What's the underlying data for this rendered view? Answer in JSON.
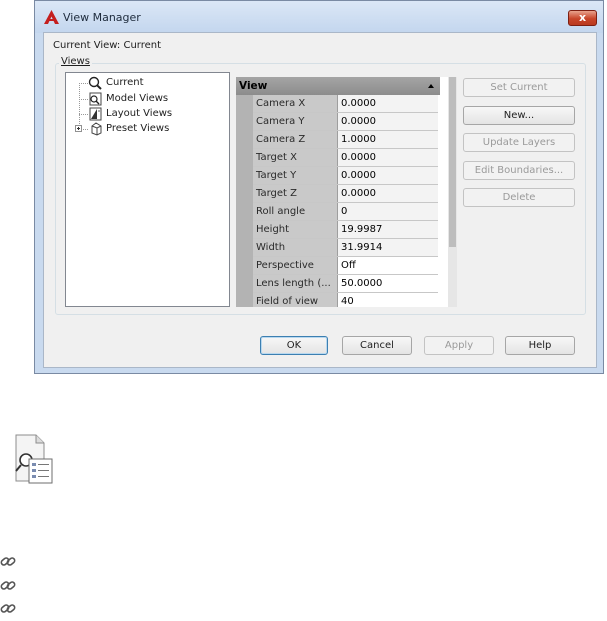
{
  "window": {
    "title": "View Manager",
    "close_glyph": "x",
    "brand_color": "#c41e1e"
  },
  "current_view": "Current View: Current",
  "views_group": {
    "label": "Views",
    "tree": [
      {
        "label": "Current",
        "icon": "magnifier-icon",
        "selected": true
      },
      {
        "label": "Model Views",
        "icon": "model-views-icon",
        "selected": false
      },
      {
        "label": "Layout Views",
        "icon": "layout-views-icon",
        "selected": false
      },
      {
        "label": "Preset Views",
        "icon": "preset-views-icon",
        "selected": false,
        "expandable": true
      }
    ]
  },
  "properties": {
    "header": "View",
    "rows": [
      {
        "name": "Camera X",
        "value": "0.0000"
      },
      {
        "name": "Camera Y",
        "value": "0.0000"
      },
      {
        "name": "Camera Z",
        "value": "1.0000"
      },
      {
        "name": "Target X",
        "value": "0.0000"
      },
      {
        "name": "Target Y",
        "value": "0.0000"
      },
      {
        "name": "Target Z",
        "value": "0.0000"
      },
      {
        "name": "Roll angle",
        "value": "0"
      },
      {
        "name": "Height",
        "value": "19.9987"
      },
      {
        "name": "Width",
        "value": "31.9914"
      },
      {
        "name": "Perspective",
        "value": "Off"
      },
      {
        "name": "Lens length (...",
        "value": "50.0000"
      },
      {
        "name": "Field of view",
        "value": "40"
      }
    ]
  },
  "side_buttons": {
    "set_current": "Set Current",
    "new": "New...",
    "update_layers": "Update Layers",
    "edit_boundaries": "Edit Boundaries...",
    "delete": "Delete"
  },
  "footer_buttons": {
    "ok": "OK",
    "cancel": "Cancel",
    "apply": "Apply",
    "help": "Help"
  },
  "below_dialog": {
    "command_icon": "view-manager-icon",
    "link_icons": [
      "link-icon",
      "link-icon",
      "link-icon"
    ]
  }
}
